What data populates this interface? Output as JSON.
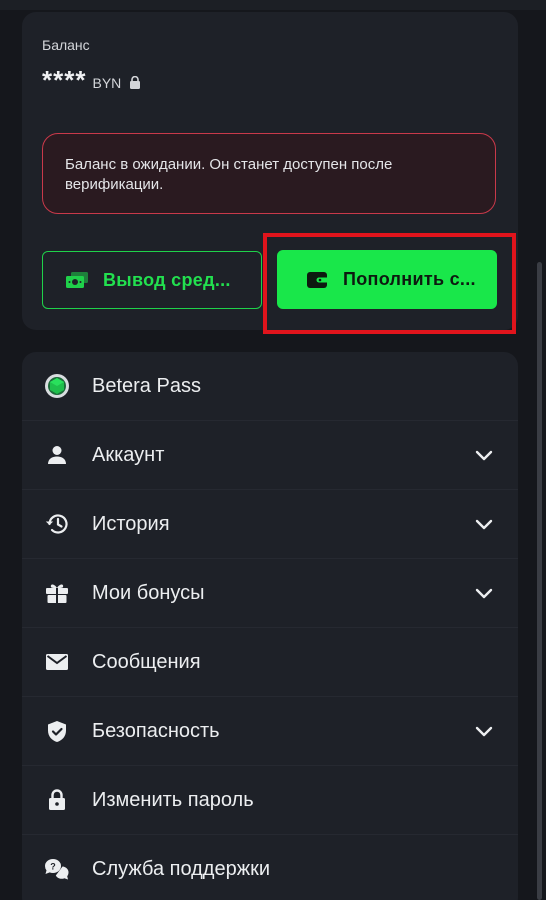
{
  "balance": {
    "label": "Баланс",
    "amount_masked": "****",
    "currency": "BYN",
    "alert_text": "Баланс в ожидании. Он станет доступен после верификации.",
    "withdraw_label": "Вывод сред...",
    "deposit_label": "Пополнить с..."
  },
  "menu": {
    "items": [
      {
        "label": "Betera Pass",
        "icon": "betera-pass-icon",
        "expandable": false
      },
      {
        "label": "Аккаунт",
        "icon": "user-icon",
        "expandable": true
      },
      {
        "label": "История",
        "icon": "history-icon",
        "expandable": true
      },
      {
        "label": "Мои бонусы",
        "icon": "gift-icon",
        "expandable": true
      },
      {
        "label": "Сообщения",
        "icon": "mail-icon",
        "expandable": false
      },
      {
        "label": "Безопасность",
        "icon": "shield-icon",
        "expandable": true
      },
      {
        "label": "Изменить пароль",
        "icon": "lock-icon",
        "expandable": false
      },
      {
        "label": "Служба поддержки",
        "icon": "support-chat-icon",
        "expandable": false
      }
    ]
  },
  "colors": {
    "accent_green": "#19e74a",
    "alert_border": "#c9394a",
    "highlight_red": "#e0141c",
    "card_bg": "#1e2128",
    "page_bg": "#15171c"
  }
}
